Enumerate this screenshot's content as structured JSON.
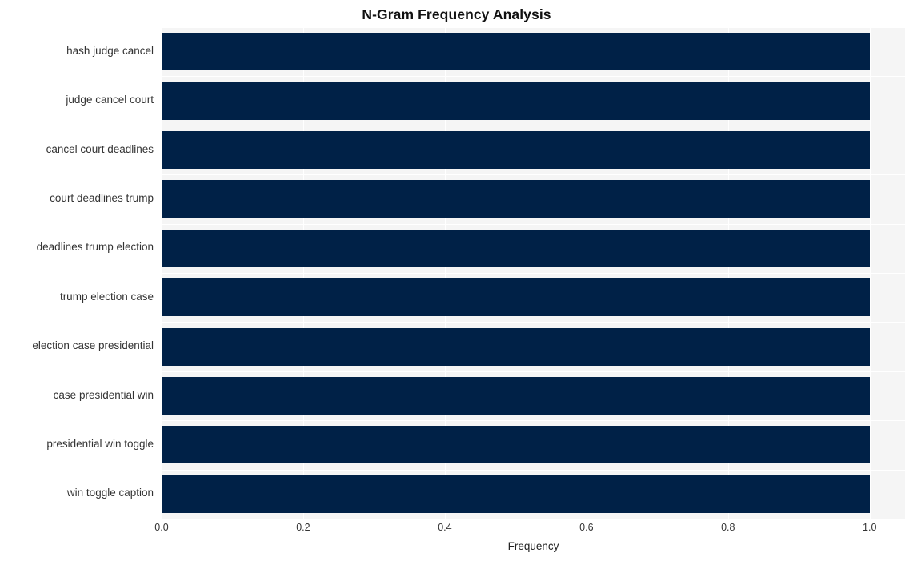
{
  "chart_data": {
    "type": "bar",
    "orientation": "horizontal",
    "title": "N-Gram Frequency Analysis",
    "xlabel": "Frequency",
    "ylabel": "",
    "xlim": [
      0.0,
      1.05
    ],
    "xticks": [
      "0.0",
      "0.2",
      "0.4",
      "0.6",
      "0.8",
      "1.0"
    ],
    "xtick_values": [
      0.0,
      0.2,
      0.4,
      0.6,
      0.8,
      1.0
    ],
    "grid": true,
    "legend": null,
    "bar_color": "#002147",
    "plot_background": "#f5f5f5",
    "figure_background": "#ffffff",
    "gridline_color": "#ffffff",
    "categories": [
      "hash judge cancel",
      "judge cancel court",
      "cancel court deadlines",
      "court deadlines trump",
      "deadlines trump election",
      "trump election case",
      "election case presidential",
      "case presidential win",
      "presidential win toggle",
      "win toggle caption"
    ],
    "values": [
      1.0,
      1.0,
      1.0,
      1.0,
      1.0,
      1.0,
      1.0,
      1.0,
      1.0,
      1.0
    ]
  }
}
